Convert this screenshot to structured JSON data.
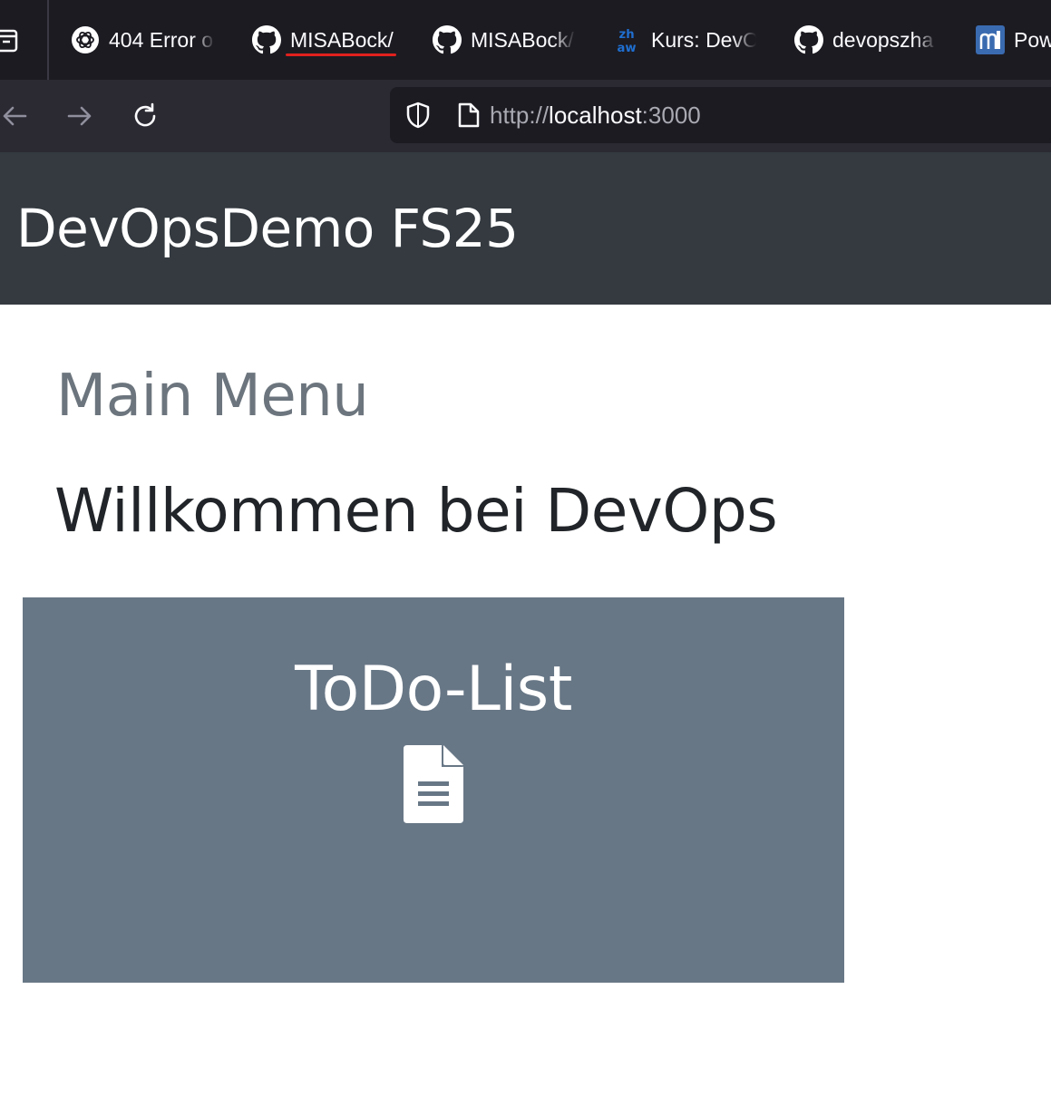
{
  "browser": {
    "tabs": [
      {
        "label": "404 Error o",
        "icon": "openai-icon"
      },
      {
        "label": "MISABock/",
        "icon": "github-icon",
        "active": true
      },
      {
        "label": "MISABock/",
        "icon": "github-icon"
      },
      {
        "label": "Kurs: DevO",
        "icon": "zhaw-icon"
      },
      {
        "label": "devopszha",
        "icon": "github-icon"
      },
      {
        "label": "Pow",
        "icon": "moodle-icon"
      }
    ],
    "url": {
      "scheme": "http://",
      "host": "localhost",
      "port": ":3000"
    },
    "accent_color": "#e0211d"
  },
  "app": {
    "brand": "DevOpsDemo FS25",
    "menu_title": "Main Menu",
    "welcome": "Willkommen bei DevOps",
    "card": {
      "title": "ToDo-List",
      "icon": "file-text-icon"
    },
    "colors": {
      "header_bg": "#343a40",
      "card_bg": "#687786",
      "muted_text": "#6c757d"
    }
  }
}
